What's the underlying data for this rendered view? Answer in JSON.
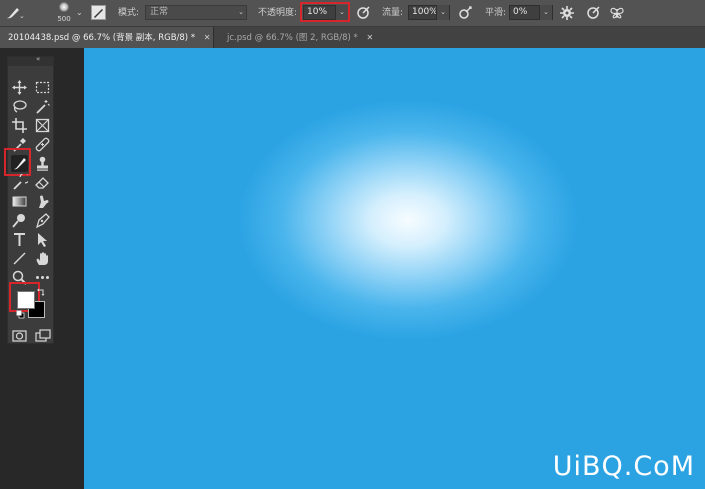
{
  "options_bar": {
    "brush_size": "500",
    "mode_label": "模式:",
    "mode_value": "正常",
    "opacity_label": "不透明度:",
    "opacity_value": "10%",
    "flow_label": "流量:",
    "flow_value": "100%",
    "smoothing_label": "平滑:",
    "smoothing_value": "0%"
  },
  "tabs": [
    {
      "title": "20104438.psd @ 66.7% (背景 副本, RGB/8) *"
    },
    {
      "title": "jc.psd @ 66.7% (图 2, RGB/8) *"
    }
  ],
  "toolbar": {
    "collapse_glyph": "«",
    "foreground_color": "#ffffff",
    "background_color": "#000000"
  },
  "canvas": {
    "center_color": "#f7fcff",
    "edge_color": "#2ba3e3"
  },
  "watermark": "UiBQ.CoM",
  "highlight_color": "#d7262b"
}
